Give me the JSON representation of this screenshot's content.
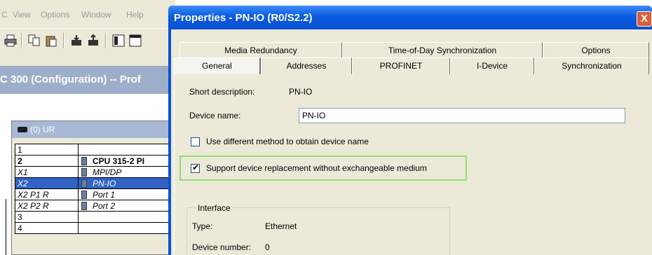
{
  "background_app": {
    "menu": [
      "C",
      "View",
      "Options",
      "Window",
      "Help"
    ],
    "window_title": "C 300 (Configuration) -- Prof",
    "rack": {
      "title": "(0) UR",
      "rows": [
        {
          "slot": "1",
          "module": ""
        },
        {
          "slot": "2",
          "module": "CPU 315-2 PI"
        },
        {
          "slot": "X1",
          "module": "MPI/DP"
        },
        {
          "slot": "X2",
          "module": "PN-IO"
        },
        {
          "slot": "X2 P1 R",
          "module": "Port 1"
        },
        {
          "slot": "X2 P2 R",
          "module": "Port 2"
        },
        {
          "slot": "3",
          "module": ""
        },
        {
          "slot": "4",
          "module": ""
        }
      ]
    }
  },
  "dialog": {
    "title": "Properties - PN-IO (R0/S2.2)",
    "close_label": "X",
    "tabs_row1": [
      "Media Redundancy",
      "Time-of-Day Synchronization",
      "Options"
    ],
    "tabs_row2": [
      "General",
      "Addresses",
      "PROFINET",
      "I-Device",
      "Synchronization"
    ],
    "active_tab": "General",
    "general": {
      "short_description_label": "Short description:",
      "short_description_value": "PN-IO",
      "device_name_label": "Device name:",
      "device_name_value": "PN-IO",
      "use_different_method_label": "Use different method to obtain device name",
      "use_different_method_checked": false,
      "support_replacement_label": "Support device replacement without exchangeable medium",
      "support_replacement_checked": true,
      "interface": {
        "legend": "Interface",
        "type_label": "Type:",
        "type_value": "Ethernet",
        "device_number_label": "Device number:",
        "device_number_value": "0"
      }
    }
  },
  "colors": {
    "title_bar": "#0b5ce0",
    "selected_row": "#3163c5",
    "highlight_box": "#92e069",
    "dialog_face": "#ece9d8"
  }
}
